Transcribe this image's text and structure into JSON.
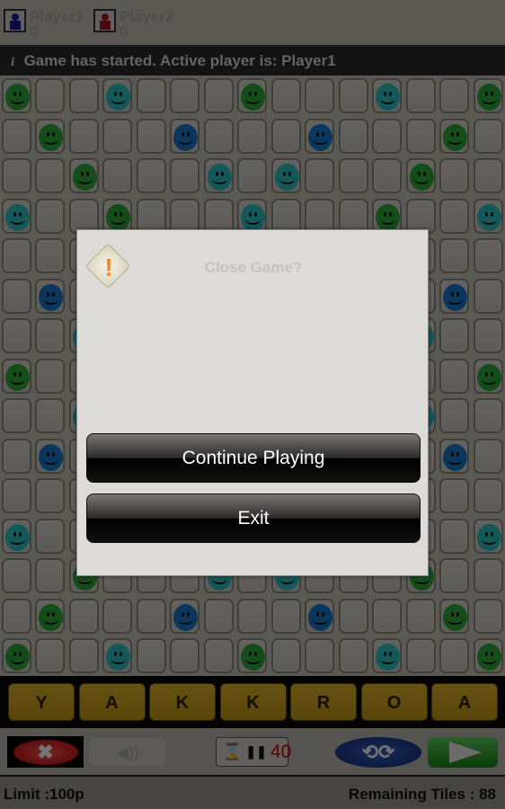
{
  "header": {
    "players": [
      {
        "name": "Player1",
        "score": "0",
        "color": "#1a1a9a"
      },
      {
        "name": "Player2",
        "score": "0",
        "color": "#a01820"
      }
    ]
  },
  "status": {
    "icon": "info-icon",
    "icon_glyph": "i",
    "text": "Game has started. Active player is: Player1"
  },
  "board": {
    "columns": 15,
    "rows": 15,
    "colors": {
      "G": "#2faa3a",
      "C": "#2fc4c8",
      "B": "#1a7ad0"
    },
    "pieces": [
      "G..C...G...C..G",
      ".G...B...B...G.",
      "..G...C.C...G..",
      "C..G...C...G..C",
      "...............",
      ".B...........B.",
      "..C.........C..",
      "G.............G",
      "..C.........C..",
      ".B...........B.",
      "...............",
      "C.............C",
      "..G...C.C...G..",
      ".G...B...B...G.",
      "G..C...G...C..G"
    ]
  },
  "tiles": [
    "Y",
    "A",
    "K",
    "K",
    "R",
    "O",
    "A"
  ],
  "controls": {
    "close_glyph": "✖",
    "sound_glyph": "◀))",
    "hourglass_glyph": "⌛",
    "pause_glyph": "❚❚",
    "timer": "40",
    "swap_glyph": "⟲⟳"
  },
  "footer": {
    "limit": "Limit :100p",
    "remaining": "Remaining Tiles :  88"
  },
  "dialog": {
    "title": "Close Game?",
    "warning_glyph": "!",
    "continue_label": "Continue Playing",
    "exit_label": "Exit"
  }
}
